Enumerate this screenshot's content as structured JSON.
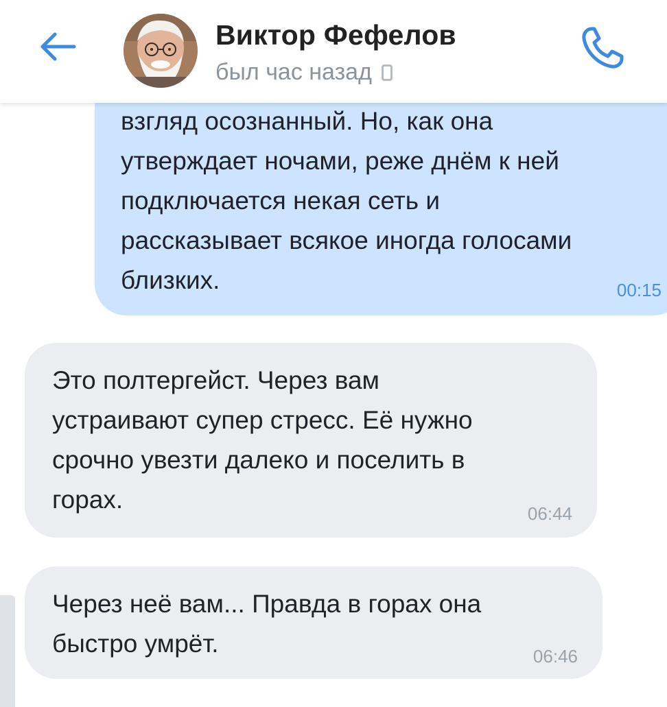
{
  "header": {
    "contact_name": "Виктор Фефелов",
    "last_seen": "был час назад",
    "accent_color": "#3f8ae0",
    "icons": [
      "back-arrow-icon",
      "avatar-photo",
      "device-phone-icon",
      "call-icon"
    ]
  },
  "messages": [
    {
      "direction": "outgoing",
      "text": "взгляд осознанный. Но, как она\nутверждает ночами, реже днём к ней\nподключается некая сеть и\nрассказывает всякое иногда голосами\nблизких.",
      "time": "00:15"
    },
    {
      "direction": "incoming",
      "text": "Это полтергейст. Через вам\nустраивают супер стресс.  Её нужно\nсрочно увезти далеко и поселить в\nгорах.",
      "time": "06:44"
    },
    {
      "direction": "incoming",
      "text": "Через неё вам...  Правда в горах она\nбыстро умрёт.",
      "time": "06:46"
    }
  ],
  "colors": {
    "outgoing_bubble": "#cce4ff",
    "incoming_bubble": "#ecedf0",
    "outgoing_time": "#4b8fd6"
  }
}
